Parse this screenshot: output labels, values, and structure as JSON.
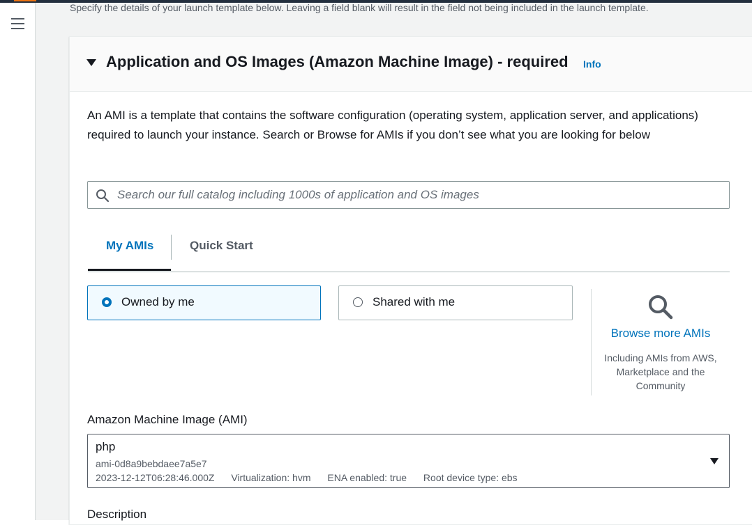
{
  "intro_text": "Specify the details of your launch template below. Leaving a field blank will result in the field not being included in the launch template.",
  "section": {
    "title": "Application and OS Images (Amazon Machine Image) - required",
    "info_label": "Info",
    "description": "An AMI is a template that contains the software configuration (operating system, application server, and applications) required to launch your instance. Search or Browse for AMIs if you don’t see what you are looking for below"
  },
  "search": {
    "placeholder": "Search our full catalog including 1000s of application and OS images",
    "value": ""
  },
  "tabs": [
    {
      "label": "My AMIs",
      "active": true
    },
    {
      "label": "Quick Start",
      "active": false
    }
  ],
  "ownership": {
    "options": [
      {
        "label": "Owned by me",
        "selected": true
      },
      {
        "label": "Shared with me",
        "selected": false
      }
    ]
  },
  "browse": {
    "link": "Browse more AMIs",
    "subtext": "Including AMIs from AWS, Marketplace and the Community"
  },
  "ami": {
    "label": "Amazon Machine Image (AMI)",
    "name": "php",
    "id": "ami-0d8a9bebdaee7a5e7",
    "created": "2023-12-12T06:28:46.000Z",
    "virtualization": "Virtualization: hvm",
    "ena": "ENA enabled: true",
    "root_device": "Root device type: ebs"
  },
  "description_label": "Description",
  "colors": {
    "link": "#0073bb",
    "selected_tile_bg": "#f1faff",
    "header_bar": "#232f3e",
    "accent": "#ec7211"
  },
  "icons": [
    "menu-icon",
    "search-icon",
    "caret-down-icon",
    "magnifier-icon"
  ]
}
